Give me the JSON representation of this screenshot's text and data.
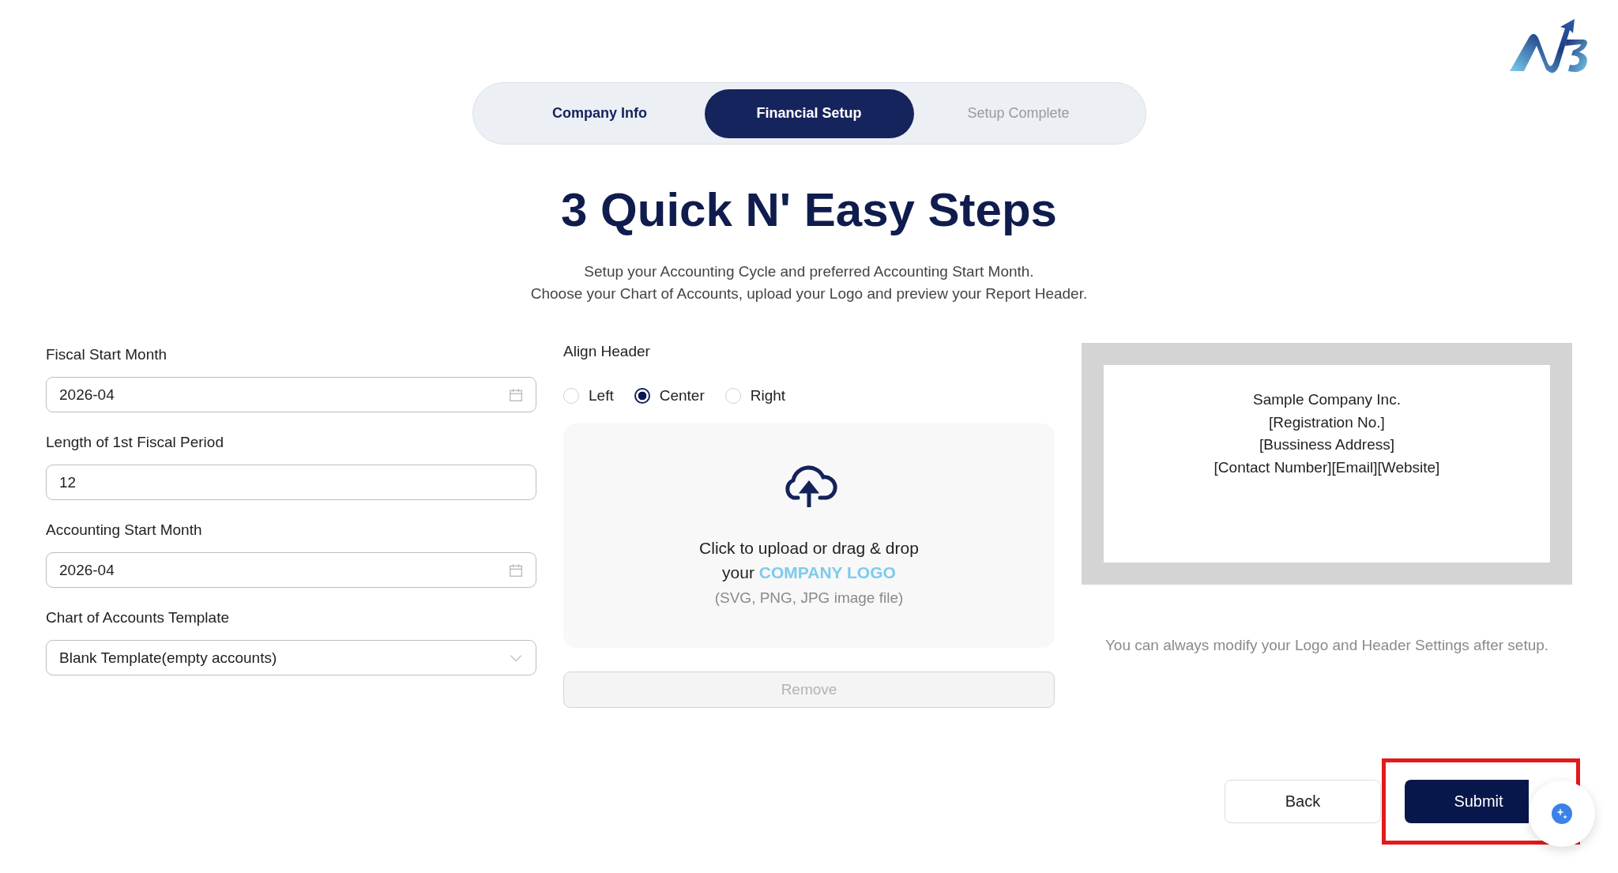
{
  "steps": [
    {
      "label": "Company Info",
      "disabled": false,
      "selected": false
    },
    {
      "label": "Financial Setup",
      "disabled": false,
      "selected": true
    },
    {
      "label": "Setup Complete",
      "disabled": true,
      "selected": false
    }
  ],
  "title": "3 Quick N' Easy Steps",
  "subtitle": [
    "Setup your Accounting Cycle and preferred Accounting Start Month.",
    "Choose your Chart of Accounts, upload your Logo and preview your Report Header."
  ],
  "fields": [
    {
      "label": "Fiscal Start Month",
      "kind": "date",
      "value": "2026-04"
    },
    {
      "label": "Length of 1st Fiscal Period",
      "kind": "text",
      "value": "12"
    },
    {
      "label": "Accounting Start Month",
      "kind": "date",
      "value": "2026-04"
    },
    {
      "label": "Chart of Accounts Template",
      "kind": "select",
      "value": "Blank Template(empty accounts)"
    }
  ],
  "align_header": {
    "label": "Align Header",
    "options": [
      {
        "label": "Left",
        "selected": false
      },
      {
        "label": "Center",
        "selected": true
      },
      {
        "label": "Right",
        "selected": false
      }
    ]
  },
  "upload": {
    "prompt": "Click to upload or drag & drop your **COMPANY LOGO**",
    "hint": "(SVG, PNG, JPG image file)"
  },
  "remove_button": {
    "label": "Remove",
    "disabled": true
  },
  "preview": {
    "lines": [
      "Sample Company Inc.",
      "[Registration No.]",
      "[Bussiness Address]",
      "[Contact Number][Email][Website]"
    ],
    "note": "You can always modify your Logo and Header Settings after setup."
  },
  "buttons": [
    {
      "label": "Back",
      "kind": "secondary"
    },
    {
      "label": "Submit",
      "kind": "primary",
      "highlighted": true
    }
  ]
}
